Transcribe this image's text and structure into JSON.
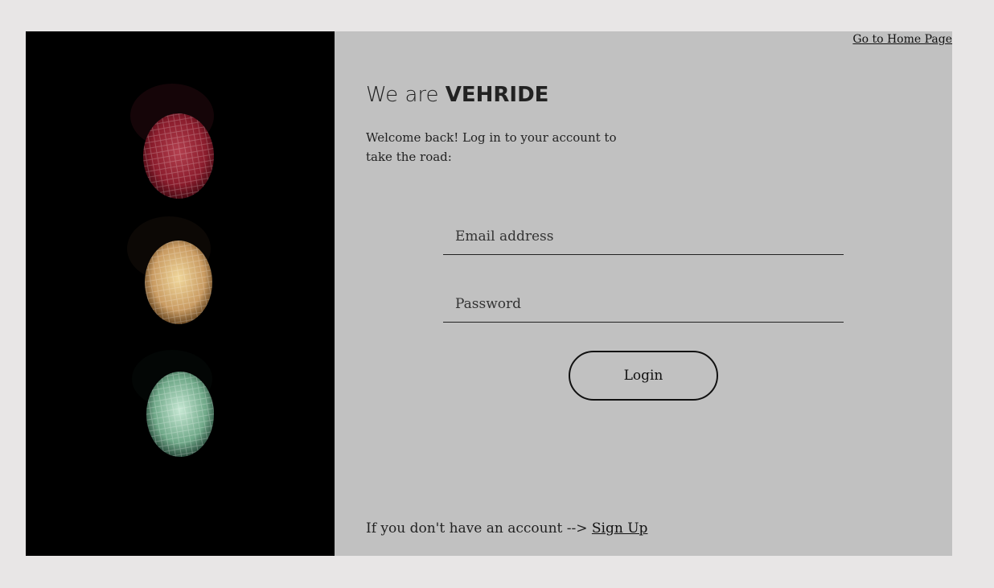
{
  "nav": {
    "home_link": "Go to Home Page"
  },
  "hero": {
    "title_prefix": "We are ",
    "title_brand": "VEHRIDE",
    "subtitle": "Welcome back! Log in to your account to take the road:"
  },
  "form": {
    "email_placeholder": "Email address",
    "email_value": "",
    "password_placeholder": "Password",
    "password_value": "",
    "login_label": "Login"
  },
  "footer": {
    "signup_prompt": "If you don't have an account --> ",
    "signup_link": "Sign Up"
  },
  "image": {
    "subject": "traffic-light",
    "lights": [
      "red",
      "amber",
      "green"
    ]
  },
  "colors": {
    "page_background": "#e8e6e6",
    "form_background": "#c1c1c1",
    "image_background": "#000000",
    "red_light": "#8a1c2c",
    "amber_light": "#d9b27a",
    "green_light": "#7fb89a"
  }
}
